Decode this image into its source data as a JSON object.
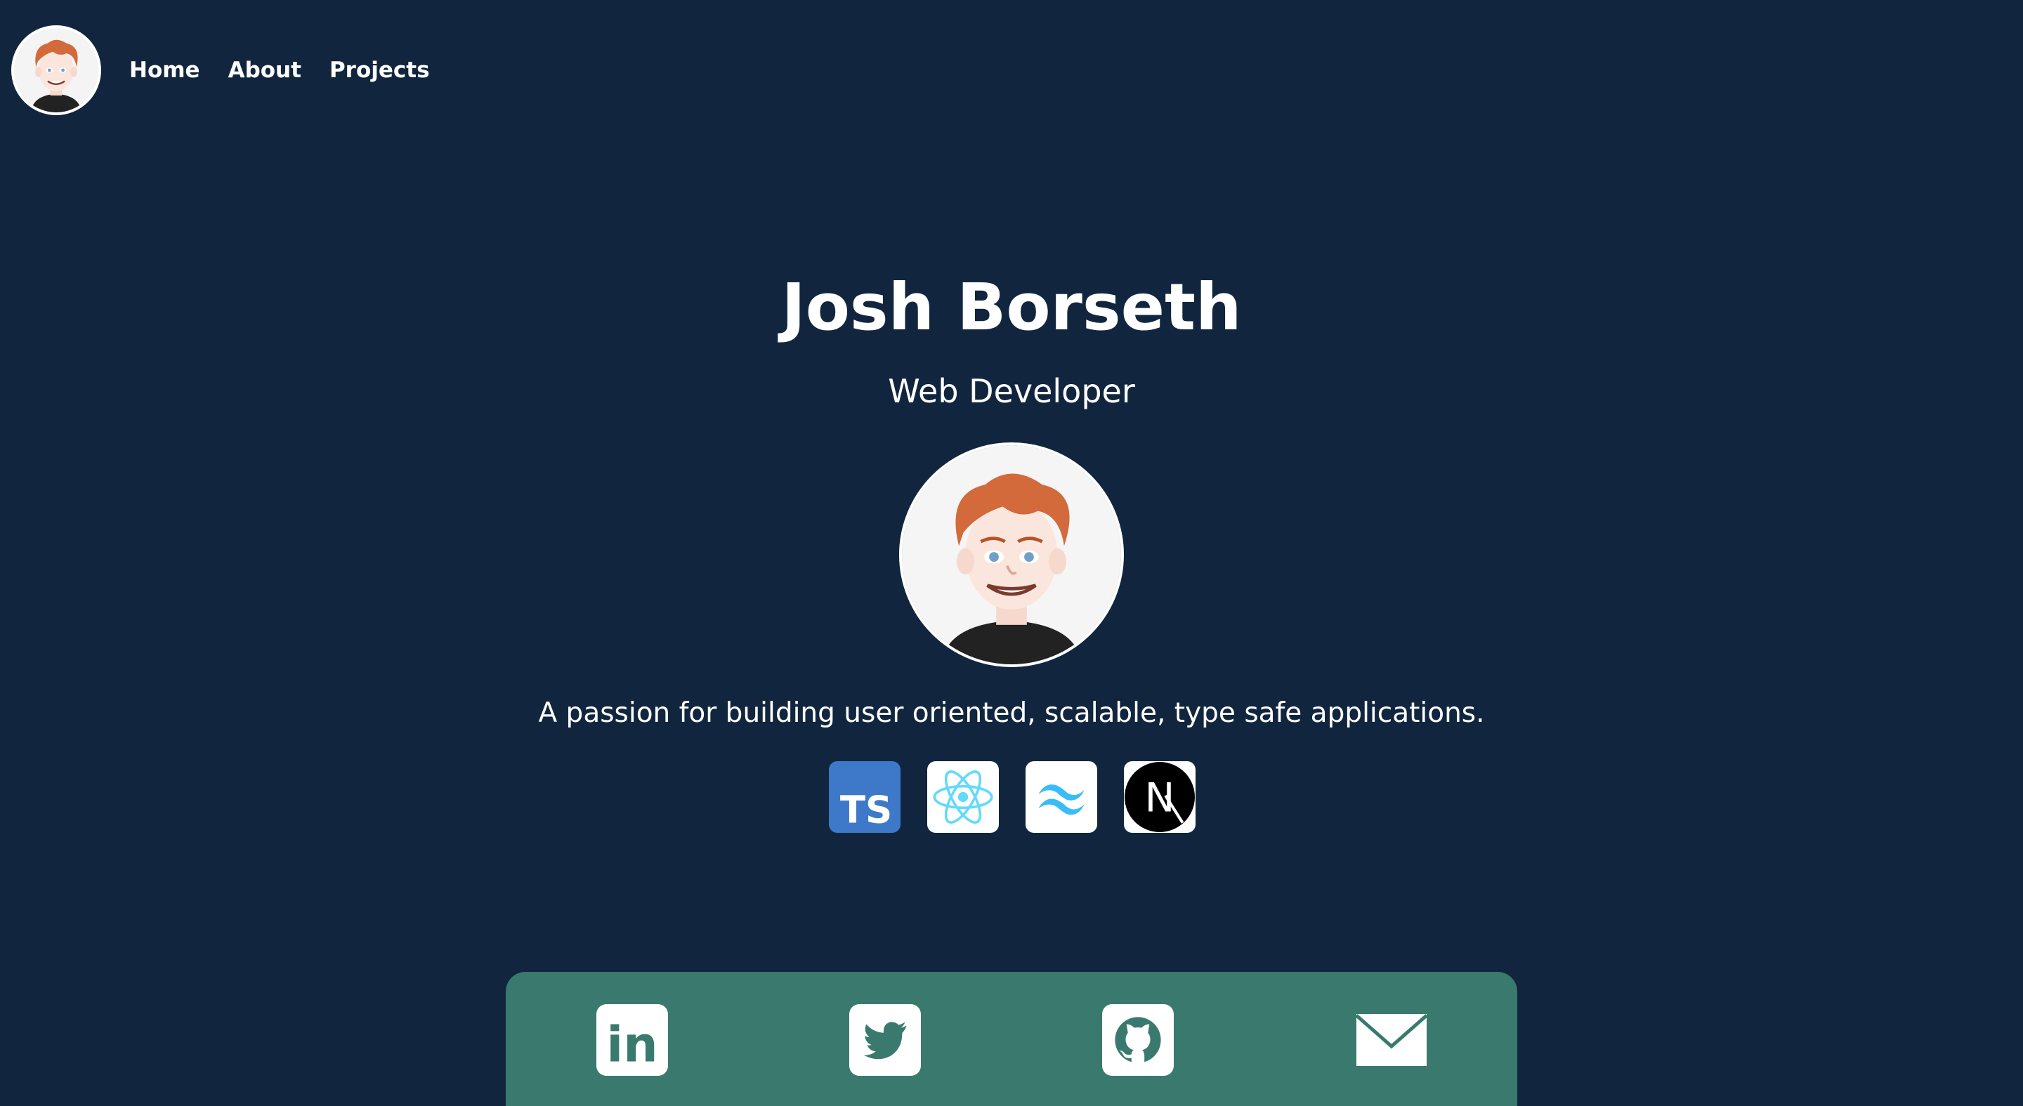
{
  "nav": {
    "avatar_icon": "memoji-avatar-icon",
    "links": [
      {
        "label": "Home"
      },
      {
        "label": "About"
      },
      {
        "label": "Projects"
      }
    ]
  },
  "hero": {
    "name": "Josh Borseth",
    "role": "Web Developer",
    "avatar_icon": "memoji-avatar-icon",
    "tagline": "A passion for building user oriented, scalable, type safe applications."
  },
  "tech_stack": [
    {
      "icon": "typescript-icon",
      "text": "TS",
      "color": "#3178c6"
    },
    {
      "icon": "react-icon",
      "color": "#61dafb"
    },
    {
      "icon": "tailwind-icon",
      "color": "#38bdf8"
    },
    {
      "icon": "nextjs-icon",
      "text": "N",
      "color": "#000000"
    }
  ],
  "social": [
    {
      "icon": "linkedin-icon",
      "text": "in"
    },
    {
      "icon": "twitter-icon"
    },
    {
      "icon": "github-icon"
    },
    {
      "icon": "email-icon"
    }
  ],
  "colors": {
    "background": "#11263e",
    "social_bar": "#3a7a6e",
    "text": "#ffffff"
  }
}
